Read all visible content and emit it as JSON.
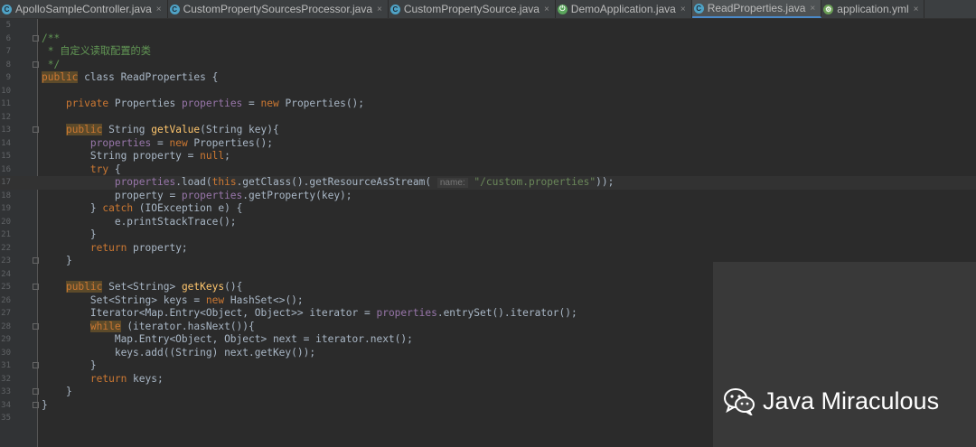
{
  "tabs": [
    {
      "label": "ApolloSampleController.java",
      "icon": "class-icon",
      "active": false
    },
    {
      "label": "CustomPropertySourcesProcessor.java",
      "icon": "class-icon",
      "active": false
    },
    {
      "label": "CustomPropertySource.java",
      "icon": "class-icon",
      "active": false
    },
    {
      "label": "DemoApplication.java",
      "icon": "spring-boot-icon",
      "active": false
    },
    {
      "label": "ReadProperties.java",
      "icon": "class-icon",
      "active": true
    },
    {
      "label": "application.yml",
      "icon": "yml-icon",
      "active": false
    }
  ],
  "close_glyph": "×",
  "param_hint": "name:",
  "line_numbers": [
    "5",
    "6",
    "7",
    "8",
    "9",
    "10",
    "11",
    "12",
    "13",
    "14",
    "15",
    "16",
    "17",
    "18",
    "19",
    "20",
    "21",
    "22",
    "23",
    "24",
    "25",
    "26",
    "27",
    "28",
    "29",
    "30",
    "31",
    "32",
    "33",
    "34",
    "35"
  ],
  "watermark": "Java Miraculous",
  "code": {
    "c6": "/**",
    "c7": " * 自定义读取配置的类",
    "c8": " */",
    "l9_kw": "public",
    "l9_rest": " class ReadProperties {",
    "l11_kw": "private",
    "l11_a": " Properties ",
    "l11_fld": "properties",
    "l11_b": " = ",
    "l11_kw2": "new",
    "l11_c": " Properties();",
    "l13_kw": "public",
    "l13_a": " String ",
    "l13_fn": "getValue",
    "l13_b": "(String key){",
    "l14_fld": "properties",
    "l14_a": " = ",
    "l14_kw": "new",
    "l14_b": " Properties();",
    "l15_a": "String property = ",
    "l15_kw": "null",
    "l15_b": ";",
    "l16_kw": "try",
    "l16_a": " {",
    "l17_fld": "properties",
    "l17_a": ".load(",
    "l17_kw": "this",
    "l17_b": ".getClass().getResourceAsStream(",
    "l17_str": "\"/custom.properties\"",
    "l17_c": "));",
    "l18_a": "property = ",
    "l18_fld": "properties",
    "l18_b": ".getProperty(key);",
    "l19_a": "} ",
    "l19_kw": "catch",
    "l19_b": " (IOException e) {",
    "l20": "e.printStackTrace();",
    "l21": "}",
    "l22_kw": "return",
    "l22_a": " property;",
    "l23": "}",
    "l25_kw": "public",
    "l25_a": " Set<String> ",
    "l25_fn": "getKeys",
    "l25_b": "(){",
    "l26_a": "Set<String> keys = ",
    "l26_kw": "new",
    "l26_b": " HashSet<>();",
    "l27_a": "Iterator<Map.Entry<Object, Object>> iterator = ",
    "l27_fld": "properties",
    "l27_b": ".entrySet().iterator();",
    "l28_kw": "while",
    "l28_a": " (iterator.hasNext()){",
    "l29": "Map.Entry<Object, Object> next = iterator.next();",
    "l30": "keys.add((String) next.getKey());",
    "l31": "}",
    "l32_kw": "return",
    "l32_a": " keys;",
    "l33": "}",
    "l34": "}"
  }
}
